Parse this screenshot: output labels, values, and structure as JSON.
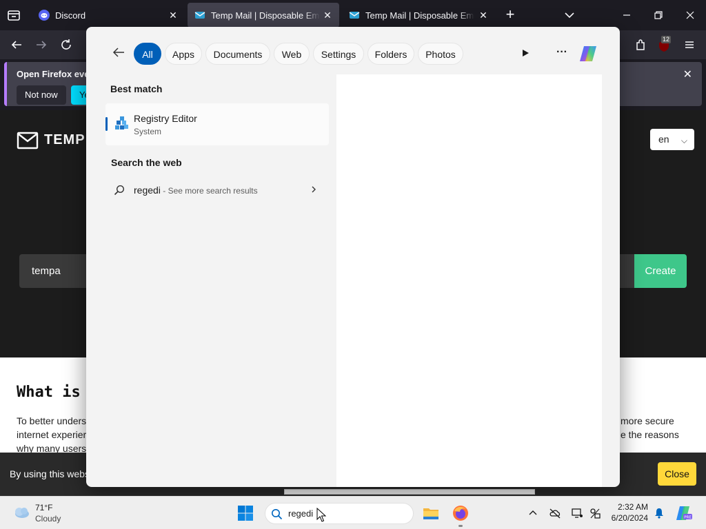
{
  "browser": {
    "tabs": [
      {
        "label": "Discord",
        "icon": "discord-icon"
      },
      {
        "label": "Temp Mail | Disposable Email Address",
        "icon": "tempmail-icon",
        "active": true
      },
      {
        "label": "Temp Mail | Disposable Email Address",
        "icon": "tempmail-icon"
      }
    ],
    "extension_badge": "12"
  },
  "notification": {
    "text": "Open Firefox every",
    "not_now_label": "Not now",
    "yes_label": "Ye"
  },
  "webpage": {
    "logo_text": "TEMP",
    "language": "en",
    "email_value": "tempa",
    "create_label": "Create",
    "heading": "What is",
    "para_line1": "To better unders",
    "para_line2": "internet experier",
    "para_line3": "why many users",
    "para_right1": "more secure",
    "para_right2": "e the reasons",
    "cookie_text": "By using this webs",
    "cookie_close_label": "Close"
  },
  "search_flyout": {
    "filters": [
      "All",
      "Apps",
      "Documents",
      "Web",
      "Settings",
      "Folders",
      "Photos"
    ],
    "active_filter": "All",
    "best_match_title": "Best match",
    "best_match": {
      "name": "Registry Editor",
      "subtitle": "System",
      "icon": "registry-editor-icon"
    },
    "search_web_title": "Search the web",
    "web_result": {
      "query": "regedi",
      "suffix": " - See more search results"
    }
  },
  "taskbar": {
    "weather_temp": "71°F",
    "weather_desc": "Cloudy",
    "search_text": "regedi",
    "time": "2:32 AM",
    "date": "6/20/2024"
  },
  "colors": {
    "accent": "#005fb8",
    "create_button": "#3ec78a",
    "cookie_close": "#ffd83a",
    "firefox_chrome": "#1c1b22"
  }
}
